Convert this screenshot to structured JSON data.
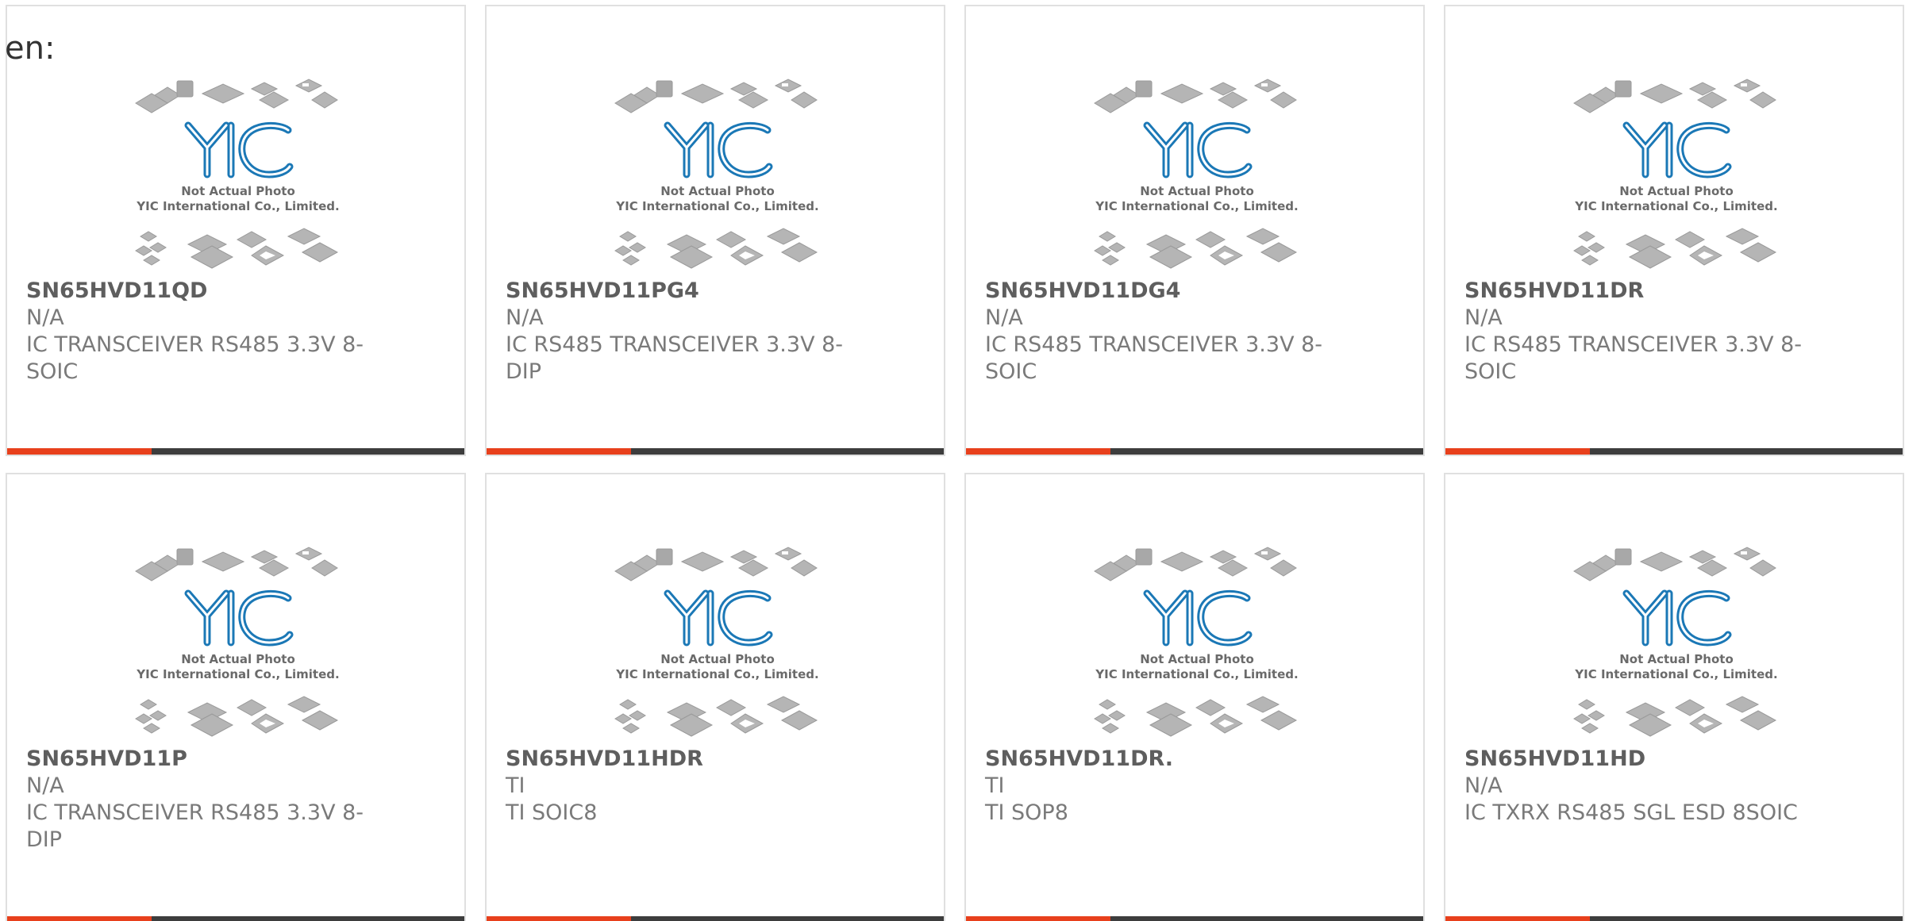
{
  "page": {
    "lang_fragment": "en:"
  },
  "placeholder_photo": {
    "icon": "yic-logo-icon",
    "line1": "Not Actual Photo",
    "line2": "YIC International Co., Limited.",
    "logo_color": "#1b78b6"
  },
  "colors": {
    "accent": "#e8401c",
    "bar": "#3d3d3d",
    "border": "#e0e0e0"
  },
  "products": [
    {
      "part": "SN65HVD11QD",
      "manufacturer": "N/A",
      "description": "IC TRANSCEIVER RS485 3.3V 8-SOIC"
    },
    {
      "part": "SN65HVD11PG4",
      "manufacturer": "N/A",
      "description": "IC RS485 TRANSCEIVER 3.3V 8-DIP"
    },
    {
      "part": "SN65HVD11DG4",
      "manufacturer": "N/A",
      "description": "IC RS485 TRANSCEIVER 3.3V 8-SOIC"
    },
    {
      "part": "SN65HVD11DR",
      "manufacturer": "N/A",
      "description": "IC RS485 TRANSCEIVER 3.3V 8-SOIC"
    },
    {
      "part": "SN65HVD11P",
      "manufacturer": "N/A",
      "description": "IC TRANSCEIVER RS485 3.3V 8-DIP"
    },
    {
      "part": "SN65HVD11HDR",
      "manufacturer": "TI",
      "description": "TI SOIC8"
    },
    {
      "part": "SN65HVD11DR.",
      "manufacturer": "TI",
      "description": "TI SOP8"
    },
    {
      "part": "SN65HVD11HD",
      "manufacturer": "N/A",
      "description": "IC TXRX RS485 SGL ESD 8SOIC"
    }
  ]
}
